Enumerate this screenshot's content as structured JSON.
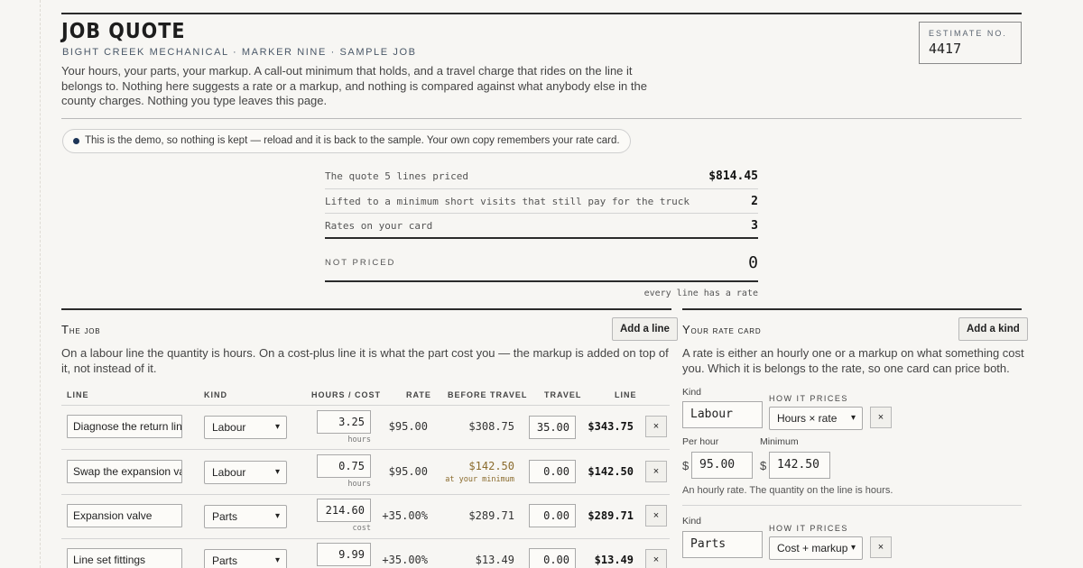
{
  "header": {
    "title": "JOB QUOTE",
    "subtitle": "BIGHT CREEK MECHANICAL · MARKER NINE · SAMPLE JOB",
    "intro": "Your hours, your parts, your markup. A call-out minimum that holds, and a travel charge that rides on the line it belongs to. Nothing here suggests a rate or a markup, and nothing is compared against what anybody else in the county charges. Nothing you type leaves this page.",
    "estimate_label": "ESTIMATE NO.",
    "estimate_value": "4417"
  },
  "notice": "This is the demo, so nothing is kept — reload and it is back to the sample. Your own copy remembers your rate card.",
  "summary": {
    "rows": [
      {
        "label": "The quote 5 lines priced",
        "value": "$814.45"
      },
      {
        "label": "Lifted to a minimum short visits that still pay for the truck",
        "value": "2"
      },
      {
        "label": "Rates on your card",
        "value": "3"
      }
    ],
    "not_priced_label": "NOT PRICED",
    "not_priced_value": "0",
    "foot": "every line has a rate"
  },
  "job": {
    "title_cap": "T",
    "title_rest": "he job",
    "add_button": "Add a line",
    "desc": "On a labour line the quantity is hours. On a cost-plus line it is what the part cost you — the markup is added on top of it, not instead of it.",
    "columns": {
      "line": "LINE",
      "kind": "KIND",
      "qty": "HOURS / COST",
      "rate": "RATE",
      "before": "BEFORE TRAVEL",
      "travel": "TRAVEL",
      "total": "LINE"
    },
    "rows": [
      {
        "name": "Diagnose the return line",
        "kind": "Labour",
        "qty": "3.25",
        "unit": "hours",
        "rate": "$95.00",
        "before": "$308.75",
        "note": "",
        "travel": "35.00",
        "total": "$343.75",
        "del": "×"
      },
      {
        "name": "Swap the expansion valve",
        "kind": "Labour",
        "qty": "0.75",
        "unit": "hours",
        "rate": "$95.00",
        "before": "$142.50",
        "note": "at your minimum",
        "travel": "0.00",
        "total": "$142.50",
        "del": "×"
      },
      {
        "name": "Expansion valve",
        "kind": "Parts",
        "qty": "214.60",
        "unit": "cost",
        "rate": "+35.00%",
        "before": "$289.71",
        "note": "",
        "travel": "0.00",
        "total": "$289.71",
        "del": "×"
      },
      {
        "name": "Line set fittings",
        "kind": "Parts",
        "qty": "9.99",
        "unit": "",
        "rate": "+35.00%",
        "before": "$13.49",
        "note": "",
        "travel": "0.00",
        "total": "$13.49",
        "del": "×"
      }
    ]
  },
  "rate_card": {
    "title_cap": "Y",
    "title_rest": "our rate card",
    "add_button": "Add a kind",
    "desc": "A rate is either an hourly one or a markup on what something cost you. Which it is belongs to the rate, so one card can price both.",
    "kind_label": "Kind",
    "how_label": "HOW IT PRICES",
    "items": [
      {
        "kind": "Labour",
        "how": "Hours × rate",
        "per_hour_label": "Per hour",
        "per_hour": "95.00",
        "minimum_label": "Minimum",
        "minimum": "142.50",
        "note": "An hourly rate. The quantity on the line is hours.",
        "currency": "$",
        "del": "×"
      },
      {
        "kind": "Parts",
        "how": "Cost + markup",
        "del": "×"
      }
    ]
  },
  "icons": {
    "chevron": "chevron-down-icon",
    "dot": "status-dot-icon"
  },
  "colors": {
    "accent": "#1d3557",
    "minimum_note": "#8a6b2d"
  }
}
